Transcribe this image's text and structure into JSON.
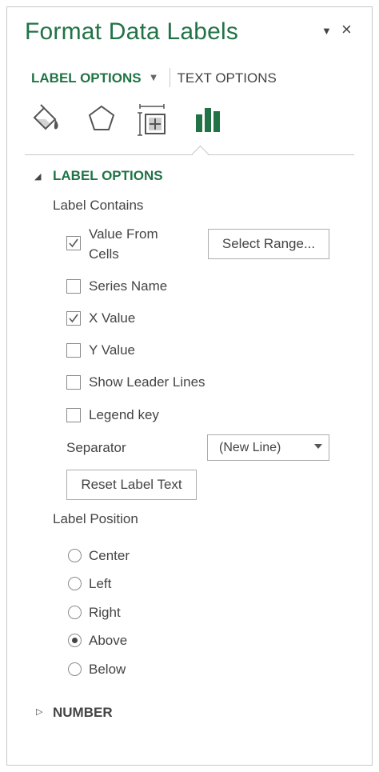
{
  "pane": {
    "title": "Format Data Labels",
    "pin_icon": "▼",
    "close_icon": "×"
  },
  "tabs": {
    "label_options": "LABEL OPTIONS",
    "dropdown_icon": "▼",
    "text_options": "TEXT OPTIONS"
  },
  "icons": [
    "fill-line-icon",
    "effects-icon",
    "size-properties-icon",
    "label-options-icon"
  ],
  "colors": {
    "accent": "#217346",
    "text": "#444444"
  },
  "section_label_options": {
    "arrow": "◢",
    "title": "LABEL OPTIONS",
    "label_contains": "Label Contains",
    "checkboxes": [
      {
        "label_line1": "Value From",
        "label_line2": "Cells",
        "checked": true
      },
      {
        "label": "Series Name",
        "checked": false
      },
      {
        "label": "X Value",
        "checked": true
      },
      {
        "label": "Y Value",
        "checked": false
      },
      {
        "label": "Show Leader Lines",
        "checked": false
      },
      {
        "label": "Legend key",
        "checked": false
      }
    ],
    "select_range_button": "Select Range...",
    "separator_label": "Separator",
    "separator_value": "(New Line)",
    "reset_button": "Reset Label Text",
    "label_position": "Label Position",
    "positions": [
      {
        "label": "Center",
        "selected": false
      },
      {
        "label": "Left",
        "selected": false
      },
      {
        "label": "Right",
        "selected": false
      },
      {
        "label": "Above",
        "selected": true
      },
      {
        "label": "Below",
        "selected": false
      }
    ]
  },
  "section_number": {
    "arrow": "▷",
    "title": "NUMBER"
  }
}
